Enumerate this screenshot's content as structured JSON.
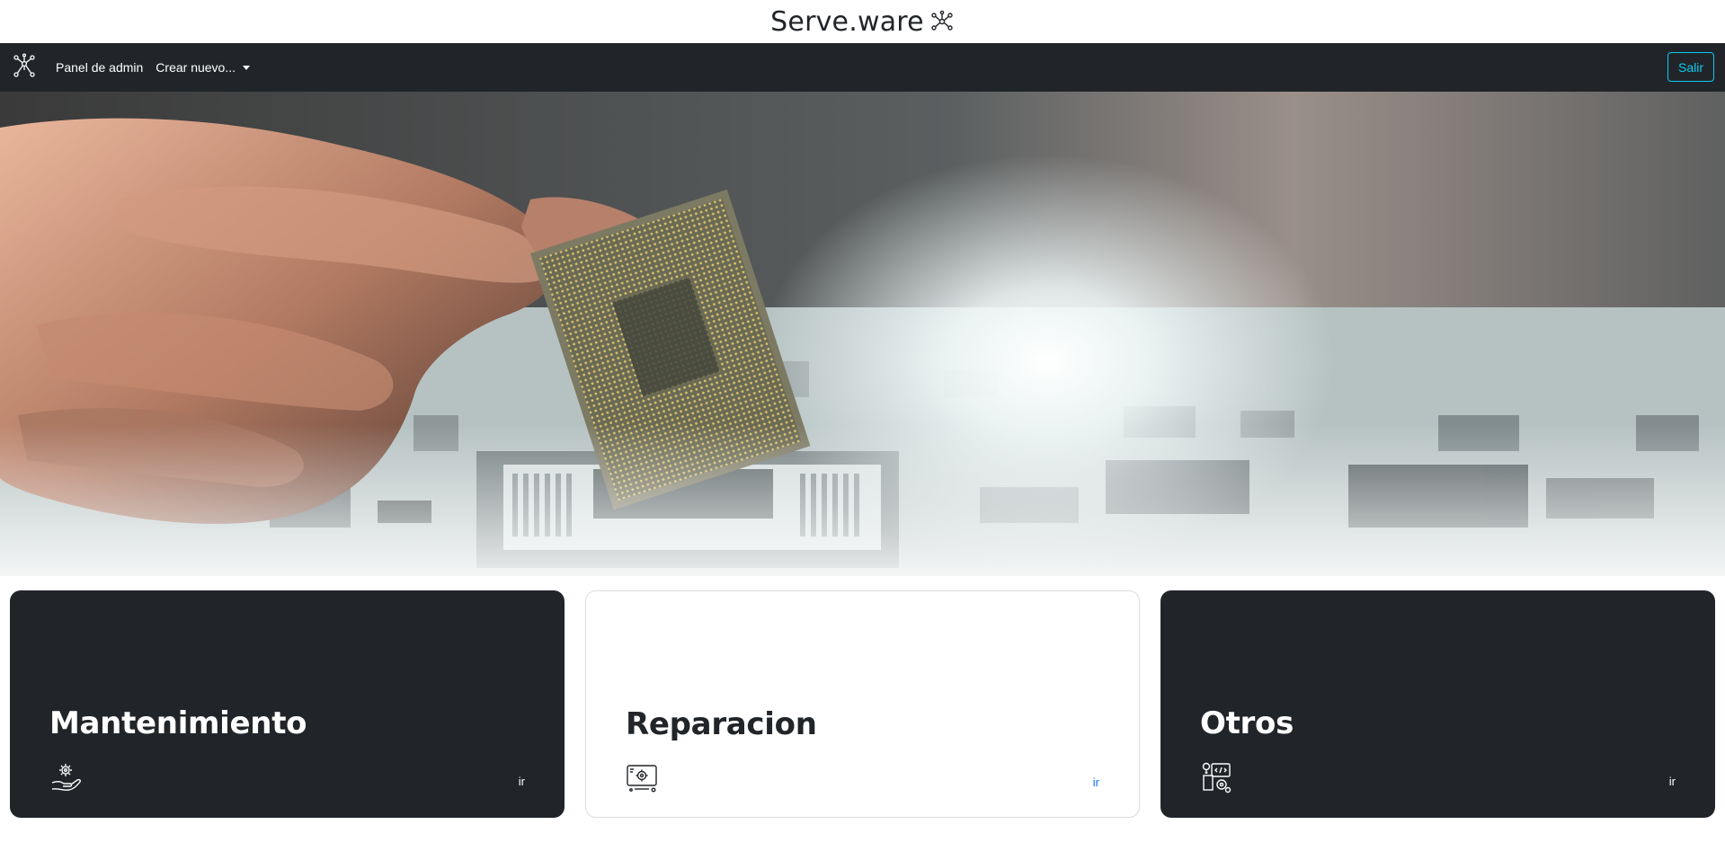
{
  "brand": {
    "title": "Serve.ware",
    "icon": "network-nodes-icon"
  },
  "navbar": {
    "logo_icon": "network-nodes-icon",
    "admin_link": "Panel de admin",
    "create_dropdown": "Crear nuevo...",
    "logout_button": "Salir"
  },
  "hero": {
    "image": "hand-holding-cpu-over-circuit-board"
  },
  "cards": [
    {
      "title": "Mantenimiento",
      "icon": "maintenance-hand-gear-icon",
      "link": "ir",
      "theme": "dark"
    },
    {
      "title": "Reparacion",
      "icon": "repair-monitor-gear-icon",
      "link": "ir",
      "theme": "light"
    },
    {
      "title": "Otros",
      "icon": "other-tools-icon",
      "link": "ir",
      "theme": "dark"
    }
  ],
  "colors": {
    "navbar_bg": "#212529",
    "card_dark_bg": "#212529",
    "outline_info": "#0dcaf0",
    "link_blue": "#0d6efd"
  }
}
